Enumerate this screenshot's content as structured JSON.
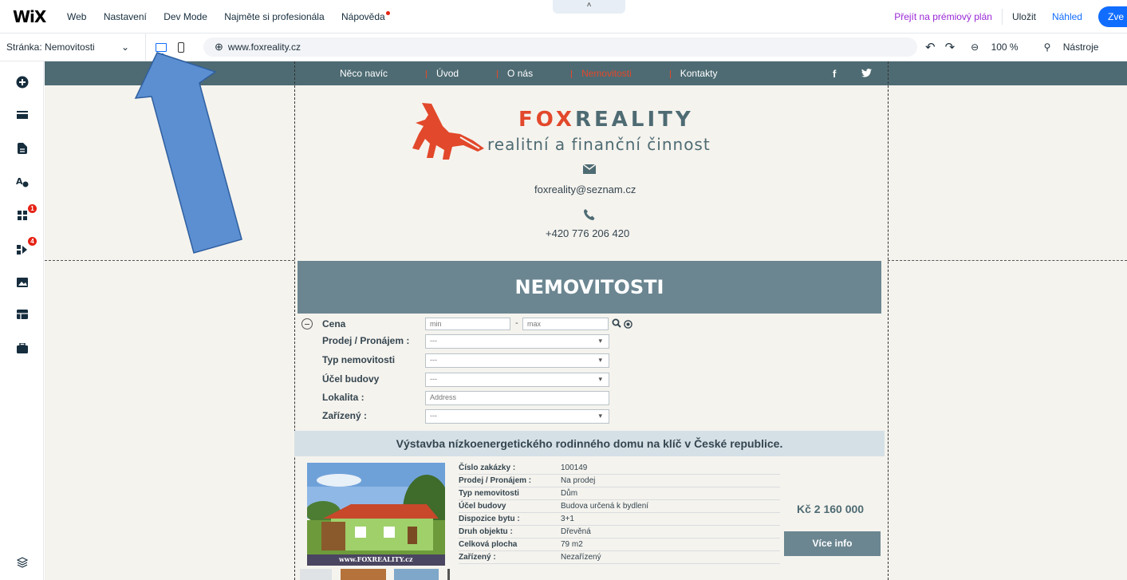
{
  "editor": {
    "logo": "WiX",
    "menu": [
      "Web",
      "Nastavení",
      "Dev Mode",
      "Najměte si profesionála",
      "Nápověda"
    ],
    "collapse_glyph": "˄",
    "premium": "Přejít na prémiový plán",
    "save": "Uložit",
    "preview": "Náhled",
    "publish": "Zve",
    "page_selector": "Stránka: Nemovitosti",
    "url": "www.foxreality.cz",
    "zoom": "100 %",
    "tools": "Nástroje",
    "undo_glyph": "↶",
    "redo_glyph": "↷",
    "chevron_glyph": "⌄",
    "globe_glyph": "⊕",
    "zoom_glyph": "⊖",
    "tools_glyph": "⚲",
    "sidebar_badges": [
      "1",
      "4"
    ]
  },
  "site": {
    "nav": [
      "Něco navíc",
      "Úvod",
      "O nás",
      "Nemovitosti",
      "Kontakty"
    ],
    "active_nav": "Nemovitosti",
    "social": [
      "f",
      "t"
    ],
    "brand_fox": "FOX",
    "brand_rest": "REALITY",
    "tagline": "realitní a finanční činnost",
    "email": "foxreality@seznam.cz",
    "phone": "+420 776 206 420",
    "section_title": "NEMOVITOSTI",
    "filters": {
      "price_label": "Cena",
      "min": "min",
      "dash": "-",
      "max": "max",
      "sale_label": "Prodej / Pronájem :",
      "type_label": "Typ nemovitosti",
      "purpose_label": "Účel budovy",
      "location_label": "Lokalita :",
      "equipment_label": "Zařízený :",
      "select_default": "---",
      "address_placeholder": "Address"
    },
    "listing": {
      "title": "Výstavba nízkoenergetického rodinného domu na klíč v České republice.",
      "watermark": "www.FOXREALITY.cz",
      "details": [
        {
          "k": "Číslo zakázky :",
          "v": "100149"
        },
        {
          "k": "Prodej / Pronájem :",
          "v": "Na prodej"
        },
        {
          "k": "Typ nemovitosti",
          "v": "Dům"
        },
        {
          "k": "Účel budovy",
          "v": "Budova určená k bydlení"
        },
        {
          "k": "Dispozice bytu :",
          "v": "3+1"
        },
        {
          "k": "Druh objektu :",
          "v": "Dřevěná"
        },
        {
          "k": "Celková plocha",
          "v": "79 m2"
        },
        {
          "k": "Zařízený :",
          "v": "Nezařízený"
        }
      ],
      "price": "Kč 2 160 000",
      "more": "Více info"
    }
  },
  "colors": {
    "accent": "#116dff",
    "nav_band": "#4e6b73",
    "fox_orange": "#e2482b",
    "arrow": "#5b8fd1"
  }
}
